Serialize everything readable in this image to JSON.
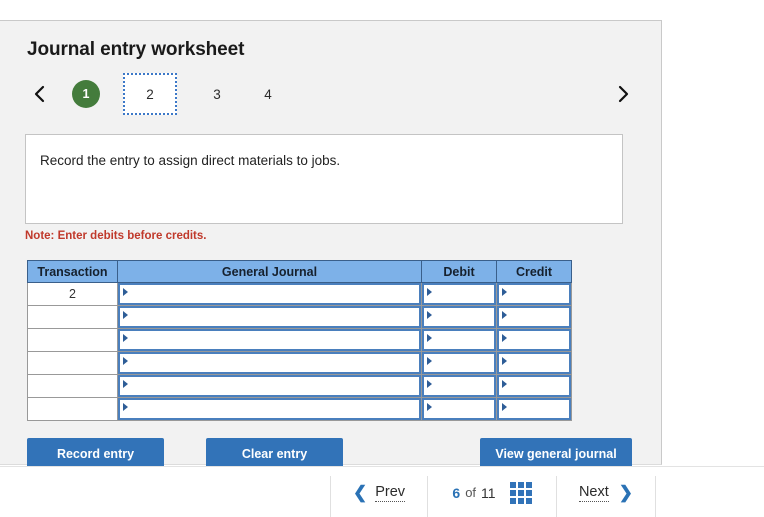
{
  "page_title": "Journal entry worksheet",
  "worksheet_nav": {
    "prev_icon": "chevron-left-icon",
    "next_icon": "chevron-right-icon",
    "tabs": [
      {
        "label": "1",
        "state": "completed"
      },
      {
        "label": "2",
        "state": "current"
      },
      {
        "label": "3",
        "state": "pending"
      },
      {
        "label": "4",
        "state": "pending"
      }
    ]
  },
  "instruction": {
    "text": "Record the entry to assign direct materials to jobs."
  },
  "note": "Note: Enter debits before credits.",
  "journal_table": {
    "headers": [
      "Transaction",
      "General Journal",
      "Debit",
      "Credit"
    ],
    "rows": [
      {
        "transaction": "2",
        "general_journal": "",
        "debit": "",
        "credit": ""
      },
      {
        "transaction": "",
        "general_journal": "",
        "debit": "",
        "credit": ""
      },
      {
        "transaction": "",
        "general_journal": "",
        "debit": "",
        "credit": ""
      },
      {
        "transaction": "",
        "general_journal": "",
        "debit": "",
        "credit": ""
      },
      {
        "transaction": "",
        "general_journal": "",
        "debit": "",
        "credit": ""
      },
      {
        "transaction": "",
        "general_journal": "",
        "debit": "",
        "credit": ""
      }
    ]
  },
  "actions": {
    "record_entry": "Record entry",
    "clear_entry": "Clear entry",
    "view_general_journal": "View general journal"
  },
  "bottom_nav": {
    "prev_label": "Prev",
    "prev_icon": "chevron-left-icon",
    "current_page": "6",
    "of_label": "of",
    "total_pages": "11",
    "grid_icon": "grid-view-icon",
    "next_label": "Next",
    "next_icon": "chevron-right-icon"
  },
  "colors": {
    "panel_bg": "#f2f2f2",
    "header_blue": "#7db1e8",
    "button_blue": "#3273b8",
    "completed_green": "#447c3c",
    "note_red": "#c0392b",
    "focus_dotted_blue": "#3c78c8",
    "cell_border_blue": "#4a7fbd",
    "link_blue": "#2a72b5"
  }
}
